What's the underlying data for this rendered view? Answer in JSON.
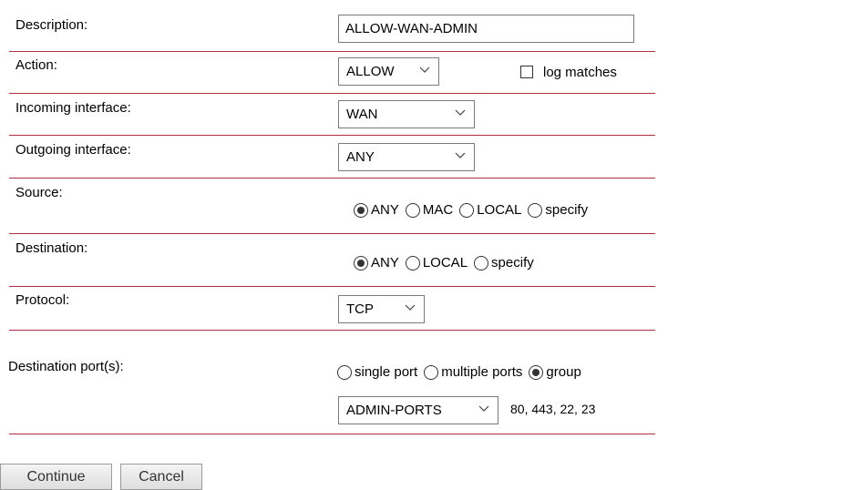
{
  "form": {
    "description": {
      "label": "Description:",
      "value": "ALLOW-WAN-ADMIN"
    },
    "action": {
      "label": "Action:",
      "value": "ALLOW",
      "log_label": "log matches",
      "log_checked": false
    },
    "incoming": {
      "label": "Incoming interface:",
      "value": "WAN"
    },
    "outgoing": {
      "label": "Outgoing interface:",
      "value": "ANY"
    },
    "source": {
      "label": "Source:",
      "options": [
        {
          "label": "ANY",
          "selected": true
        },
        {
          "label": "MAC",
          "selected": false
        },
        {
          "label": "LOCAL",
          "selected": false
        },
        {
          "label": "specify",
          "selected": false
        }
      ]
    },
    "destination": {
      "label": "Destination:",
      "options": [
        {
          "label": "ANY",
          "selected": true
        },
        {
          "label": "LOCAL",
          "selected": false
        },
        {
          "label": "specify",
          "selected": false
        }
      ]
    },
    "protocol": {
      "label": "Protocol:",
      "value": "TCP"
    },
    "dest_ports": {
      "label": "Destination port(s):",
      "options": [
        {
          "label": "single port",
          "selected": false
        },
        {
          "label": "multiple ports",
          "selected": false
        },
        {
          "label": "group",
          "selected": true
        }
      ],
      "group_value": "ADMIN-PORTS",
      "group_ports": "80, 443, 22, 23"
    }
  },
  "buttons": {
    "continue": "Continue",
    "cancel": "Cancel"
  },
  "colors": {
    "divider": "#b0303d"
  }
}
